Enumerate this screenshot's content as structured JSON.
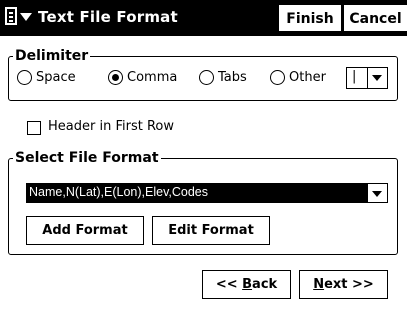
{
  "titlebar": {
    "title": "Text File Format",
    "menu_icon": "document-menu-icon",
    "finish_label": "Finish",
    "cancel_label": "Cancel"
  },
  "delimiter": {
    "legend": "Delimiter",
    "options": [
      {
        "label": "Space",
        "selected": false
      },
      {
        "label": "Comma",
        "selected": true
      },
      {
        "label": "Tabs",
        "selected": false
      },
      {
        "label": "Other",
        "selected": false
      }
    ],
    "other_value": "|"
  },
  "header_checkbox": {
    "label": "Header in First Row",
    "checked": false
  },
  "file_format": {
    "legend": "Select File Format",
    "selected_value": "Name,N(Lat),E(Lon),Elev,Codes",
    "add_label": "Add Format",
    "edit_label": "Edit Format"
  },
  "nav": {
    "back_label": "ack",
    "back_prefix": "<< ",
    "back_mnemonic": "B",
    "next_mnemonic": "N",
    "next_label": "ext >>"
  }
}
